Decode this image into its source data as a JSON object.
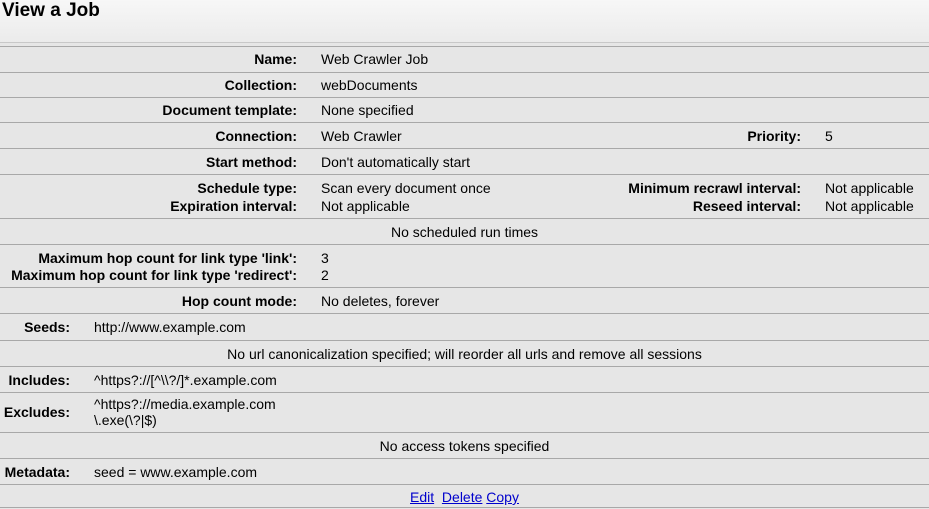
{
  "page": {
    "title": "View a Job"
  },
  "job": {
    "name_label": "Name:",
    "name": "Web Crawler Job",
    "collection_label": "Collection:",
    "collection": "webDocuments",
    "template_label": "Document template:",
    "template": "None specified",
    "connection_label": "Connection:",
    "connection": "Web Crawler",
    "priority_label": "Priority:",
    "priority": "5",
    "start_label": "Start method:",
    "start": "Don't automatically start",
    "schedule_type_label": "Schedule type:",
    "schedule_type": "Scan every document once",
    "min_recrawl_label": "Minimum recrawl interval:",
    "min_recrawl": "Not applicable",
    "expiration_label": "Expiration interval:",
    "expiration": "Not applicable",
    "reseed_label": "Reseed interval:",
    "reseed": "Not applicable",
    "run_times": "No scheduled run times",
    "hop_link_label": "Maximum hop count for link type 'link':",
    "hop_link": "3",
    "hop_redirect_label": "Maximum hop count for link type 'redirect':",
    "hop_redirect": "2",
    "hop_mode_label": "Hop count mode:",
    "hop_mode": "No deletes, forever",
    "seeds_label": "Seeds:",
    "seeds": "http://www.example.com",
    "canonicalization": "No url canonicalization specified; will reorder all urls and remove all sessions",
    "includes_label": "Includes:",
    "includes": "^https?://[^\\\\?/]*.example.com",
    "excludes_label": "Excludes:",
    "excludes": [
      "^https?://media.example.com",
      "\\.exe(\\?|$)"
    ],
    "access_tokens": "No access tokens specified",
    "metadata_label": "Metadata:",
    "metadata": "seed = www.example.com"
  },
  "actions": {
    "edit": "Edit",
    "delete": "Delete",
    "copy": "Copy"
  }
}
